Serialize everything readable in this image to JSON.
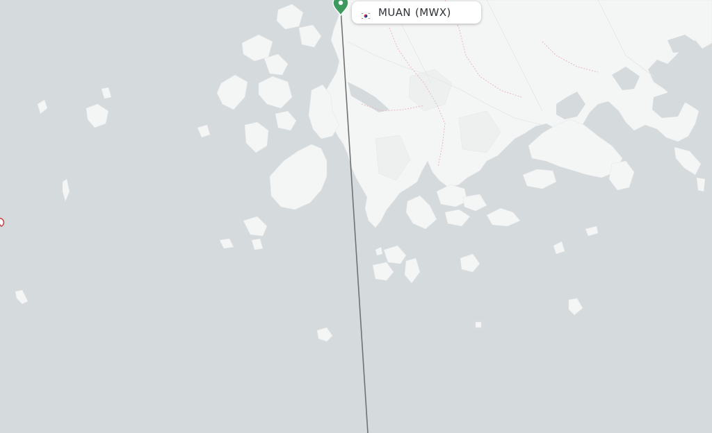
{
  "map": {
    "origin_airport": {
      "city": "MUAN",
      "code": "(MWX)",
      "country_flag": "south-korea-flag"
    },
    "colors": {
      "sea": "#d5dadd",
      "land": "#f4f5f5",
      "route_line": "#6f7173",
      "origin_pin": "#3c9a5f",
      "other_marker": "#c64a4a",
      "border": "#e8b9bd"
    }
  }
}
